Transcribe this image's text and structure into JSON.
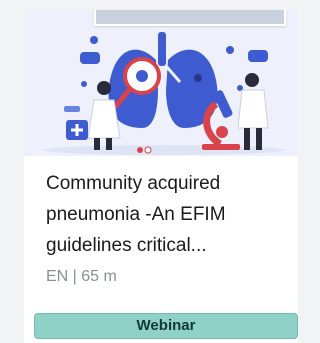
{
  "card": {
    "title": "Community acquired pneumonia -An EFIM guidelines critical...",
    "meta": "EN | 65 m",
    "badge": "Webinar",
    "thumbnail_icon": "lungs-doctors-illustration"
  },
  "colors": {
    "hero_bg": "#eef1fb",
    "lungs": "#3f5bd0",
    "accent_red": "#d9434b",
    "badge_bg": "#8fd1c6"
  }
}
